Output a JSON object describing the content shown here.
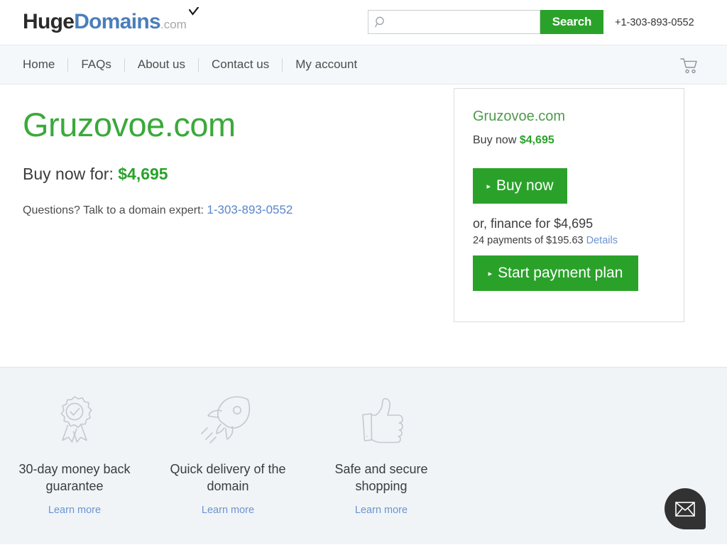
{
  "header": {
    "logo": {
      "part1": "Huge",
      "part2": "Domains",
      "part3": ".com",
      "check_icon": "check-icon"
    },
    "search": {
      "value": "",
      "placeholder": "",
      "button_label": "Search",
      "icon": "search-icon"
    },
    "phone": "+1-303-893-0552"
  },
  "nav": {
    "items": [
      {
        "label": "Home"
      },
      {
        "label": "FAQs"
      },
      {
        "label": "About us"
      },
      {
        "label": "Contact us"
      },
      {
        "label": "My account"
      }
    ],
    "cart_icon": "shopping-cart-icon"
  },
  "main": {
    "domain_title": "Gruzovoe.com",
    "buy_now_prefix": "Buy now for: ",
    "buy_now_price": "$4,695",
    "questions_prefix": "Questions? Talk to a domain expert: ",
    "questions_phone": "1-303-893-0552"
  },
  "card": {
    "domain": "Gruzovoe.com",
    "buy_now_prefix": "Buy now ",
    "buy_now_price": "$4,695",
    "buy_now_button": "Buy now",
    "finance_line": "or, finance for $4,695",
    "payments_line": "24 payments of $195.63 ",
    "details_link": "Details",
    "start_plan_button": "Start payment plan",
    "arrow_glyph": "▸"
  },
  "features": [
    {
      "icon": "award-ribbon-icon",
      "label": "30-day money back guarantee",
      "link": "Learn more"
    },
    {
      "icon": "rocket-icon",
      "label": "Quick delivery of the domain",
      "link": "Learn more"
    },
    {
      "icon": "thumbs-up-icon",
      "label": "Safe and secure shopping",
      "link": "Learn more"
    }
  ],
  "chat": {
    "icon": "envelope-icon"
  },
  "colors": {
    "brand_green": "#2aa22a",
    "title_green": "#3ba93b",
    "logo_blue": "#4a7ebb",
    "link_blue": "#6b93d0",
    "footer_bg": "#f0f4f7",
    "nav_bg": "#f5f8fa"
  }
}
